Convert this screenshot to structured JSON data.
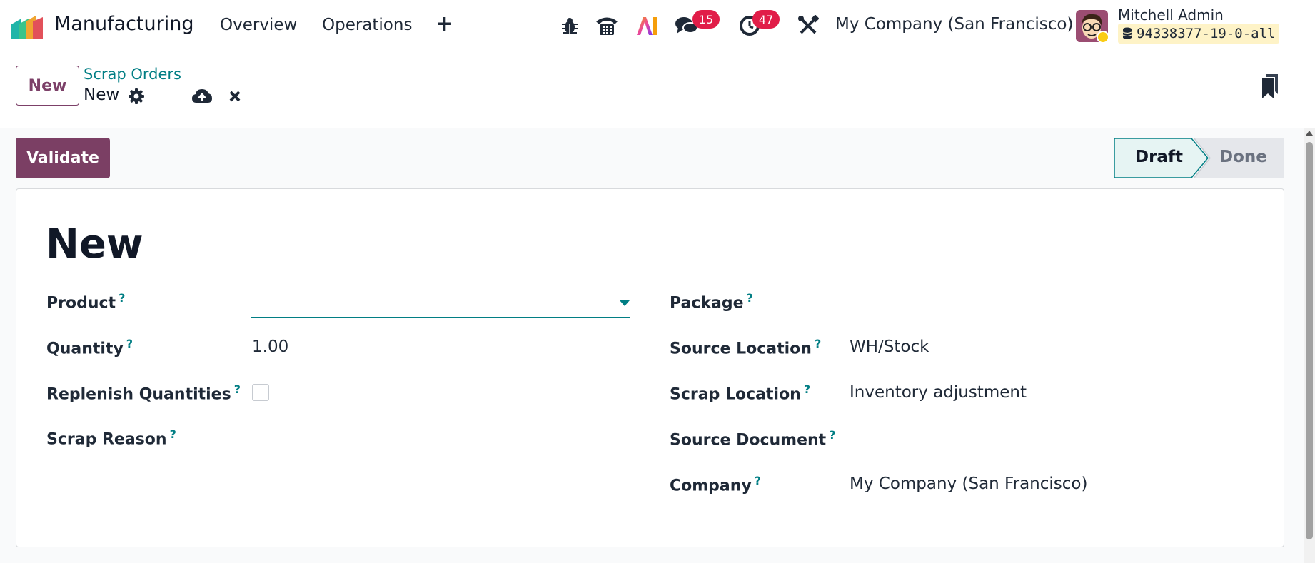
{
  "navbar": {
    "app_name": "Manufacturing",
    "menus": [
      "Overview",
      "Operations"
    ],
    "add_icon": "plus-icon",
    "messages_count": "15",
    "activities_count": "47",
    "company": "My Company (San Francisco)",
    "user_name": "Mitchell Admin",
    "database": "94338377-19-0-all"
  },
  "control_panel": {
    "new_label": "New",
    "breadcrumb": "Scrap Orders",
    "record_name": "New"
  },
  "actions": {
    "validate_label": "Validate"
  },
  "statusbar": {
    "stages": [
      "Draft",
      "Done"
    ],
    "active": "Draft"
  },
  "form": {
    "title": "New",
    "left_fields": {
      "product_label": "Product",
      "product_value": "",
      "quantity_label": "Quantity",
      "quantity_value": "1.00",
      "replenish_label": "Replenish Quantities",
      "replenish_checked": false,
      "reason_label": "Scrap Reason"
    },
    "right_fields": {
      "package_label": "Package",
      "source_location_label": "Source Location",
      "source_location_value": "WH/Stock",
      "scrap_location_label": "Scrap Location",
      "scrap_location_value": "Inventory adjustment",
      "source_document_label": "Source Document",
      "company_label": "Company",
      "company_value": "My Company (San Francisco)"
    },
    "help_marker": "?"
  },
  "colors": {
    "brand": "#7b3f64",
    "accent": "#017e84",
    "badge": "#e11d48"
  }
}
